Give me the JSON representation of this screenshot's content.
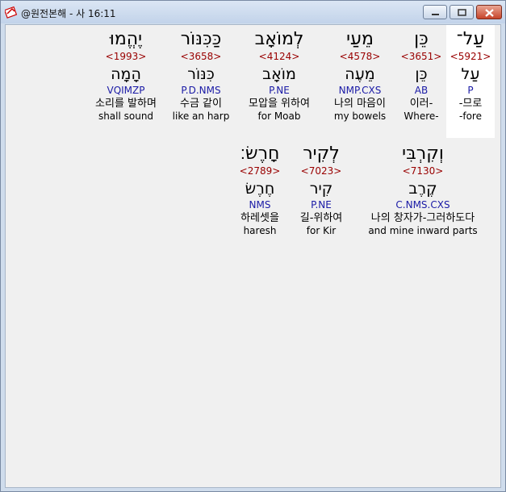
{
  "window": {
    "title": "@원전본해 - 사 16:11"
  },
  "words": [
    {
      "hebrew": "עַל־",
      "strongs": "<5921>",
      "lemma": "עַל",
      "morph": "P",
      "korean": "-므로",
      "english": "-fore",
      "highlighted": true
    },
    {
      "hebrew": "כֵּן",
      "strongs": "<3651>",
      "lemma": "כֵּן",
      "morph": "AB",
      "korean": "이러-",
      "english": "Where-",
      "highlighted": false
    },
    {
      "hebrew": "מֵעַי",
      "strongs": "<4578>",
      "lemma": "מֵעֶה",
      "morph": "NMP.CXS",
      "korean": "나의 마음이",
      "english": "my bowels",
      "highlighted": false
    },
    {
      "hebrew": "לְמוֹאָב",
      "strongs": "<4124>",
      "lemma": "מוֹאָב",
      "morph": "P.NE",
      "korean": "모압을 위하여",
      "english": "for Moab",
      "highlighted": false
    },
    {
      "hebrew": "כַּכִּנּוֹר",
      "strongs": "<3658>",
      "lemma": "כִּנּוֹר",
      "morph": "P.D.NMS",
      "korean": "수금 같이",
      "english": "like an harp",
      "highlighted": false
    },
    {
      "hebrew": "יֶהֱמוּ",
      "strongs": "<1993>",
      "lemma": "הָמָה",
      "morph": "VQIMZP",
      "korean": "소리를 발하며",
      "english": "shall sound",
      "highlighted": false
    },
    {
      "hebrew": "וְקִרְבִּי",
      "strongs": "<7130>",
      "lemma": "קֶרֶב",
      "morph": "C.NMS.CXS",
      "korean": "나의 창자가-그러하도다",
      "english": "and mine inward parts",
      "highlighted": false
    },
    {
      "hebrew": "לְקִיר",
      "strongs": "<7023>",
      "lemma": "קִיר",
      "morph": "P.NE",
      "korean": "길-위하여",
      "english": "for Kir",
      "highlighted": false
    },
    {
      "hebrew": "חָרֶשׂ׃",
      "strongs": "<2789>",
      "lemma": "חֶרֶשׂ",
      "morph": "NMS",
      "korean": "하레셋을",
      "english": "haresh",
      "highlighted": false
    }
  ]
}
